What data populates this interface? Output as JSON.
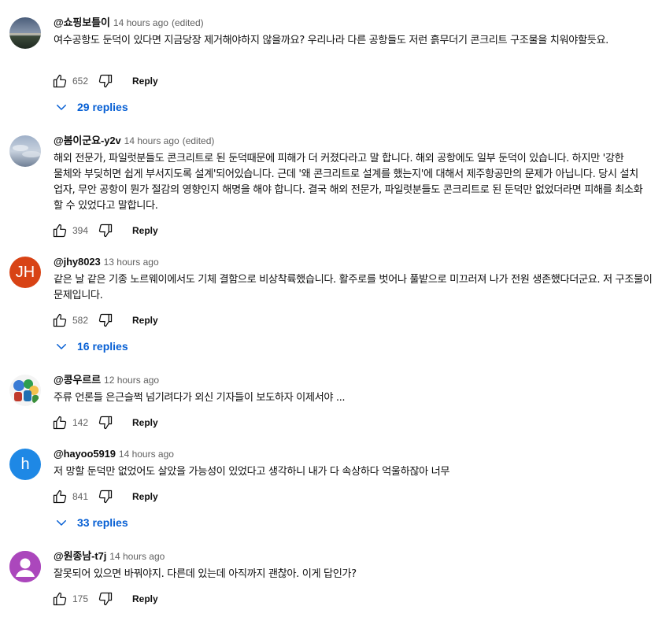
{
  "colors": {
    "link_blue": "#065fd4",
    "meta_gray": "#606060",
    "text": "#0f0f0f"
  },
  "comments": [
    {
      "author": "@쇼핑보틀이",
      "time": "14 hours ago",
      "edited": "(edited)",
      "text": "여수공항도 둔덕이 있다면 지금당장 제거해야하지 않을까요? 우리나라 다른 공항들도 저런 흙무더기 콘크리트 구조물을 치워야할듯요.",
      "likes": "652",
      "reply_label": "Reply",
      "replies": "29 replies",
      "avatar_icon": "landscape-photo-icon"
    },
    {
      "author": "@봄이군요-y2v",
      "time": "14 hours ago",
      "edited": "(edited)",
      "text": "해외 전문가, 파일럿분들도 콘크리트로 된 둔덕때문에 피해가 더 커졌다라고 말 합니다. 해외 공항에도 일부 둔덕이 있습니다. 하지만 '강한 물체와 부딪히면 쉽게 부서지도록 설계'되어있습니다. 근데 '왜 콘크리트로 설계를 했는지'에 대해서 제주항공만의 문제가 아닙니다. 당시 설치 업자, 무안 공항이 뭔가 절감의 영향인지 해명을 해야 합니다. 결국 해외 전문가, 파일럿분들도 콘크리트로 된 둔덕만 없었더라면 피해를 최소화 할 수 있었다고 말합니다.",
      "likes": "394",
      "reply_label": "Reply",
      "replies": "",
      "avatar_icon": "sky-photo-icon"
    },
    {
      "author": "@jhy8023",
      "time": "13 hours ago",
      "edited": "",
      "text": "같은 날 같은 기종 노르웨이에서도 기체 결함으로 비상착륙했습니다. 활주로를 벗어나 풀밭으로 미끄러져 나가 전원 생존했다더군요. 저 구조물이 문제입니다.",
      "likes": "582",
      "reply_label": "Reply",
      "replies": "16 replies",
      "avatar_letter": "JH",
      "avatar_color": "#d84315"
    },
    {
      "author": "@콩우르르",
      "time": "12 hours ago",
      "edited": "",
      "text": "주류 언론들 은근슬쩍 넘기려다가 외신 기자들이 보도하자 이제서야 ...",
      "likes": "142",
      "reply_label": "Reply",
      "replies": "",
      "avatar_icon": "cartoon-characters-icon"
    },
    {
      "author": "@hayoo5919",
      "time": "14 hours ago",
      "edited": "",
      "text": "저 망할 둔덕만 없었어도 살았을 가능성이 있었다고 생각하니 내가 다 속상하다 억울하잖아 너무",
      "likes": "841",
      "reply_label": "Reply",
      "replies": "33 replies",
      "avatar_letter": "h",
      "avatar_color": "#1e88e5"
    },
    {
      "author": "@원종남-t7j",
      "time": "14 hours ago",
      "edited": "",
      "text": "잘못되어  있으면 바꿔야지. 다른데  있는데 아직까지  괜찮아. 이게 답인가?",
      "likes": "175",
      "reply_label": "Reply",
      "replies": "",
      "avatar_icon": "default-user-icon",
      "avatar_color": "#ab47bc"
    }
  ]
}
